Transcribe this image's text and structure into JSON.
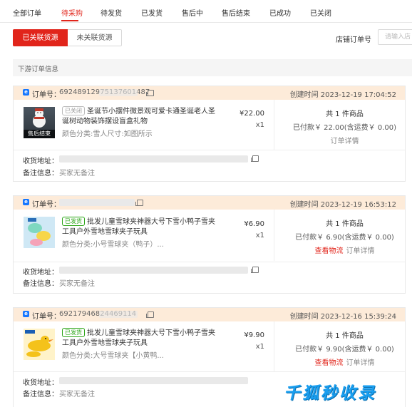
{
  "tabs": [
    "全部订单",
    "待采购",
    "待发货",
    "已发货",
    "售后中",
    "售后结束",
    "已成功",
    "已关闭"
  ],
  "filter": {
    "linked": "已关联货源",
    "unlinked": "未关联货源"
  },
  "shop_order": {
    "label": "店铺订单号",
    "placeholder": "请输入店"
  },
  "section_title": "下游订单信息",
  "orders": [
    {
      "order_label": "订单号：",
      "order_no": "69248912975137601487",
      "created": "创建时间 2023-12-19 17:04:52",
      "status_badge": "已关闭",
      "title": "圣诞节小摆件微景观可爱卡通圣诞老人圣诞树动物装饰摆设盲盒礼物",
      "spec": "颜色分类:雪人尺寸:如图所示",
      "thumb_tag": "售后结束",
      "price": "¥22.00",
      "qty": "x1",
      "count": "共 1 件商品",
      "paid": "已付款￥ 22.00(含运费￥ 0.00)",
      "logistics": "",
      "detail": "订单详情",
      "address_label": "收货地址：",
      "remark_label": "备注信息：",
      "remark": "买家无备注"
    },
    {
      "order_label": "订单号：",
      "order_no": "",
      "created": "创建时间 2023-12-19 16:53:12",
      "status_badge": "已发货",
      "title": "批发儿童雪球夹神器大号下雪小鸭子雪夹工具户外雪地雪球夹子玩具",
      "spec": "颜色分类:小号雪球夹（鸭子）...",
      "thumb_tag": "",
      "price": "¥6.90",
      "qty": "x1",
      "count": "共 1 件商品",
      "paid": "已付款￥ 6.90(含运费￥ 0.00)",
      "logistics": "查看物流",
      "detail": "订单详情",
      "address_label": "收货地址：",
      "remark_label": "备注信息：",
      "remark": "买家无备注"
    },
    {
      "order_label": "订单号：",
      "order_no": "69217946824469114",
      "created": "创建时间 2023-12-16 15:39:24",
      "status_badge": "已发货",
      "title": "批发儿童雪球夹神器大号下雪小鸭子雪夹工具户外雪地雪球夹子玩具",
      "spec": "颜色分类:大号雪球夹【小黄鸭...",
      "thumb_tag": "",
      "price": "¥9.90",
      "qty": "x1",
      "count": "共 1 件商品",
      "paid": "已付款￥ 9.90(含运费￥ 0.00)",
      "logistics": "查看物流",
      "detail": "订单详情",
      "address_label": "收货地址：",
      "remark_label": "备注信息：",
      "remark": "买家无备注"
    }
  ],
  "watermark": "千狐秒收录"
}
